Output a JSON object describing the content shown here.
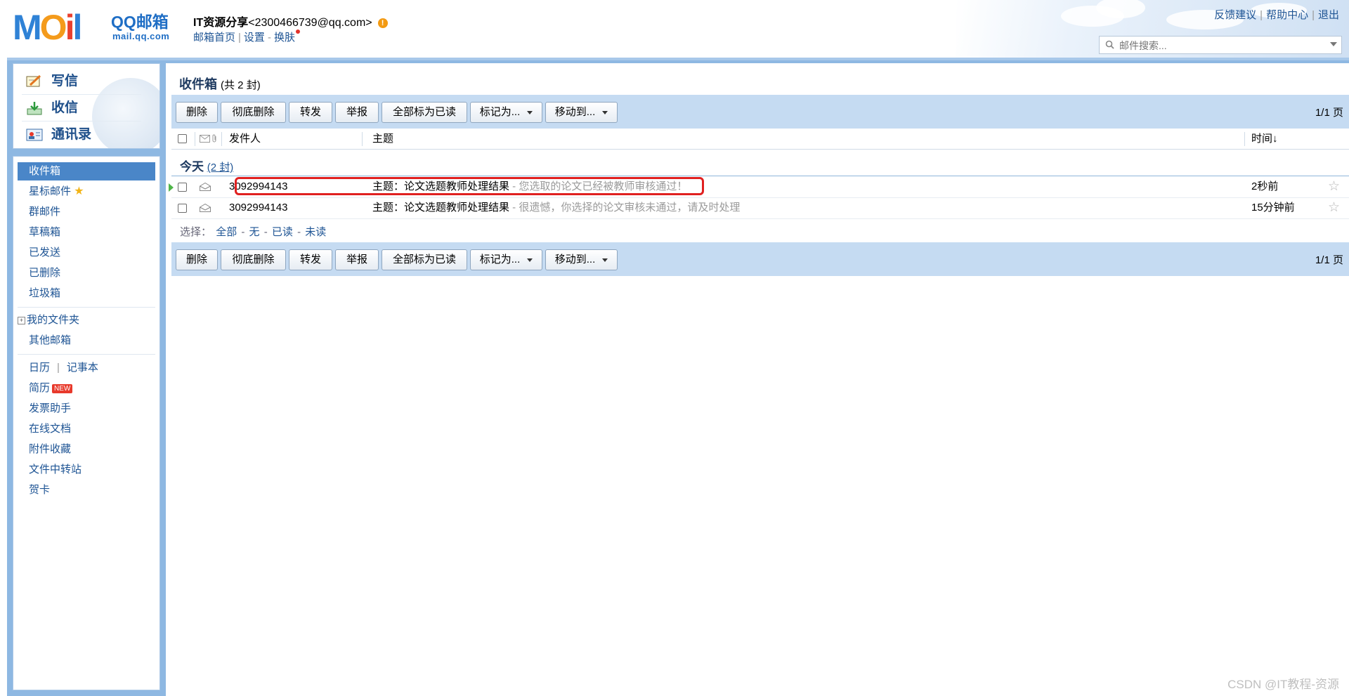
{
  "header": {
    "logo_text": "MOil",
    "brand": "QQ邮箱",
    "domain": "mail.qq.com",
    "account_name": "IT资源分享",
    "account_email": "<2300466739@qq.com>",
    "links": [
      "邮箱首页",
      "设置",
      "换肤"
    ],
    "top_links": [
      "反馈建议",
      "帮助中心",
      "退出"
    ],
    "search_placeholder": "邮件搜索..."
  },
  "quick": {
    "compose": "写信",
    "receive": "收信",
    "contacts": "通讯录"
  },
  "nav": {
    "inbox": "收件箱",
    "starred": "星标邮件",
    "group": "群邮件",
    "drafts": "草稿箱",
    "sent": "已发送",
    "deleted": "已删除",
    "spam": "垃圾箱",
    "my_folders": "我的文件夹",
    "other_mail": "其他邮箱",
    "calendar": "日历",
    "notebook": "记事本",
    "resume": "简历",
    "new_badge": "NEW",
    "invoice": "发票助手",
    "docs": "在线文档",
    "attachments": "附件收藏",
    "transfer": "文件中转站",
    "cards": "贺卡"
  },
  "main": {
    "title": "收件箱",
    "count": "(共 2 封)",
    "toolbar": {
      "delete": "删除",
      "purge": "彻底删除",
      "forward": "转发",
      "report": "举报",
      "mark_all_read": "全部标为已读",
      "mark_as": "标记为...",
      "move_to": "移动到...",
      "pager": "1/1 页"
    },
    "columns": {
      "sender": "发件人",
      "subject": "主题",
      "time": "时间↓"
    },
    "group_label": "今天",
    "group_count": "(2 封)",
    "emails": [
      {
        "sender": "3092994143",
        "subject": "主题：论文选题教师处理结果",
        "preview": " - 您选取的论文已经被教师审核通过！",
        "time": "2秒前"
      },
      {
        "sender": "3092994143",
        "subject": "主题：论文选题教师处理结果",
        "preview": " - 很遗憾，你选择的论文审核未通过，请及时处理",
        "time": "15分钟前"
      }
    ],
    "select": {
      "label": "选择：",
      "all": "全部",
      "none": "无",
      "read": "已读",
      "unread": "未读"
    }
  },
  "watermark": "CSDN @IT教程-资源",
  "colors": {
    "accent": "#4a86c8",
    "toolbar_bg": "#c5dbf2",
    "frame": "#8eb8e2",
    "highlight": "#e02020"
  }
}
